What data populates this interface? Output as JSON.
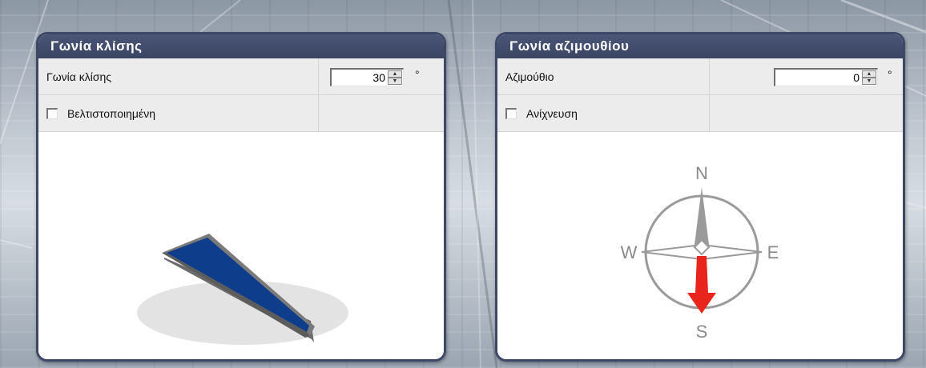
{
  "tilt_panel": {
    "title": "Γωνία κλίσης",
    "tilt_label": "Γωνία κλίσης",
    "tilt_value": "30",
    "unit": "°",
    "optimized_label": "Βελτιστοποιημένη",
    "optimized_checked": false
  },
  "azimuth_panel": {
    "title": "Γωνία αζιμουθίου",
    "azimuth_label": "Αζιμούθιο",
    "azimuth_value": "0",
    "unit": "°",
    "tracking_label": "Ανίχνευση",
    "tracking_checked": false,
    "compass": {
      "north": "N",
      "south": "S",
      "east": "E",
      "west": "W"
    }
  },
  "icons": {
    "spin_up": "▲",
    "spin_down": "▼"
  },
  "colors": {
    "panel_header": "#3d4766",
    "solar_module": "#0e3d8c",
    "compass_arrow": "#e8241c",
    "compass_gray": "#9a9a9a"
  }
}
